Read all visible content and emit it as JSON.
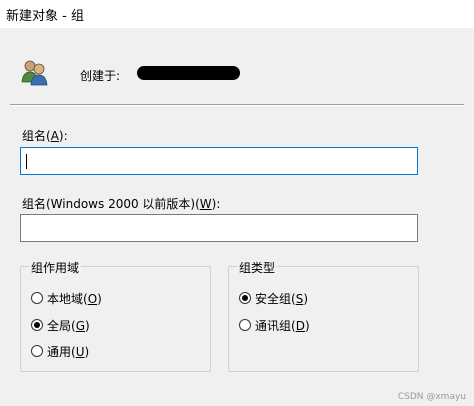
{
  "window": {
    "title": "新建对象 - 组"
  },
  "header": {
    "created_in_label": "创建于:"
  },
  "fields": {
    "group_name": {
      "label_prefix": "组名(",
      "label_key": "A",
      "label_suffix": "):",
      "value": ""
    },
    "group_name_pre2000": {
      "label_prefix": "组名(Windows 2000 以前版本)(",
      "label_key": "W",
      "label_suffix": "):",
      "value": ""
    }
  },
  "group_scope": {
    "title": "组作用域",
    "options": [
      {
        "text": "本地域(",
        "key": "O",
        "tail": ")",
        "checked": false
      },
      {
        "text": "全局(",
        "key": "G",
        "tail": ")",
        "checked": true
      },
      {
        "text": "通用(",
        "key": "U",
        "tail": ")",
        "checked": false
      }
    ]
  },
  "group_type": {
    "title": "组类型",
    "options": [
      {
        "text": "安全组(",
        "key": "S",
        "tail": ")",
        "checked": true
      },
      {
        "text": "通讯组(",
        "key": "D",
        "tail": ")",
        "checked": false
      }
    ]
  },
  "watermark": "CSDN @xmayu",
  "icons": {
    "header": "users-group-icon"
  }
}
